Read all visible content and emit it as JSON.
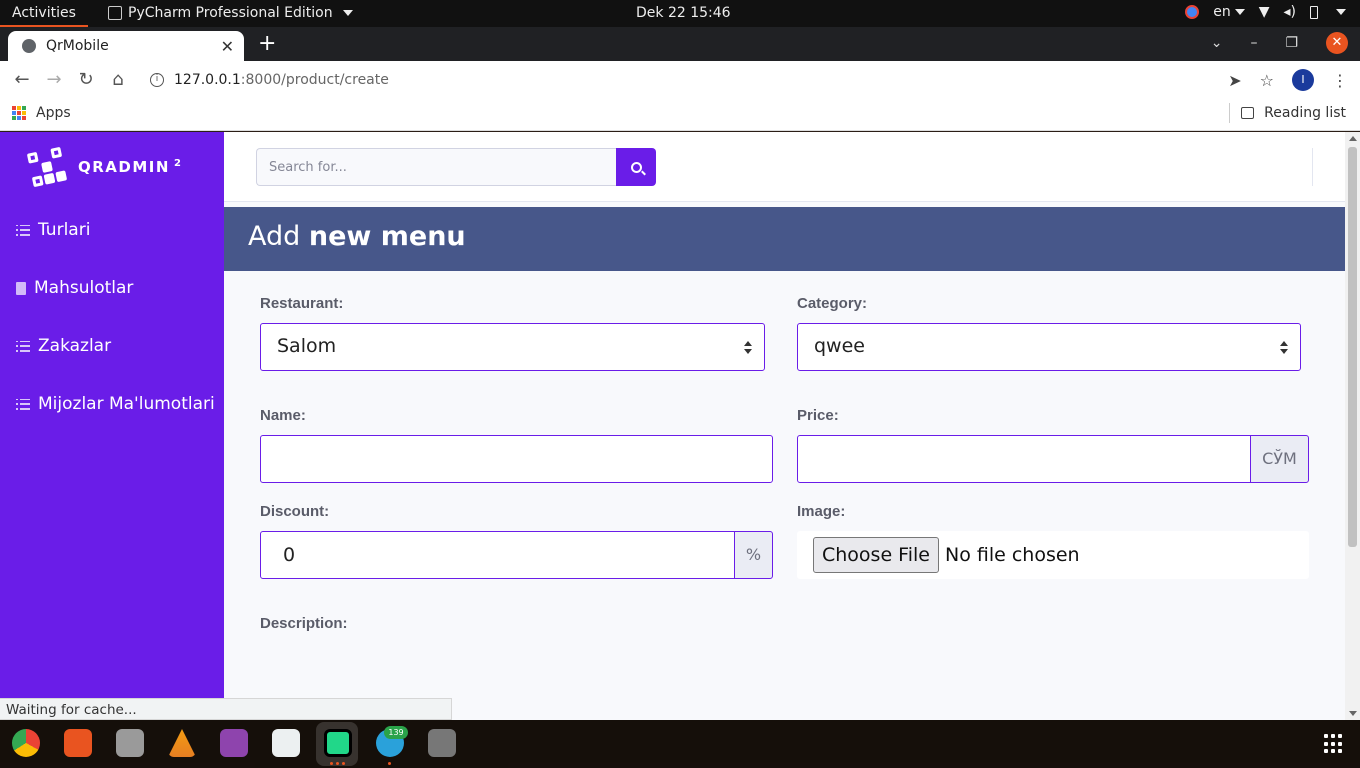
{
  "os": {
    "activities": "Activities",
    "app_menu": "PyCharm Professional Edition",
    "clock": "Dek 22  15:46",
    "language": "en"
  },
  "browser": {
    "tab_title": "QrMobile",
    "url_host": "127.0.0.1",
    "url_rest": ":8000/product/create",
    "profile_initial": "I",
    "bookmarks_apps": "Apps",
    "reading_list": "Reading list",
    "status_text": "Waiting for cache..."
  },
  "sidebar": {
    "brand": "QRADMIN",
    "brand_sup": "2",
    "items": [
      {
        "label": "Turlari",
        "icon": "list-icon"
      },
      {
        "label": "Mahsulotlar",
        "icon": "clipboard-icon"
      },
      {
        "label": "Zakazlar",
        "icon": "list-icon"
      },
      {
        "label": "Mijozlar Ma'lumotlari",
        "icon": "list-icon"
      }
    ]
  },
  "topnav": {
    "search_placeholder": "Search for..."
  },
  "page": {
    "title_light": "Add",
    "title_bold": "new menu"
  },
  "form": {
    "restaurant_label": "Restaurant:",
    "restaurant_value": "Salom",
    "category_label": "Category:",
    "category_value": "qwee",
    "name_label": "Name:",
    "name_value": "",
    "price_label": "Price:",
    "price_value": "",
    "price_currency": "СЎМ",
    "discount_label": "Discount:",
    "discount_value": "0",
    "discount_unit": "%",
    "image_label": "Image:",
    "choose_file": "Choose File",
    "no_file": "No file chosen",
    "description_label": "Description:"
  },
  "dock": {
    "telegram_badge": "139"
  },
  "colors": {
    "sidebar": "#6a1de8",
    "header": "#47578a",
    "ubuntu_accent": "#e95420"
  }
}
